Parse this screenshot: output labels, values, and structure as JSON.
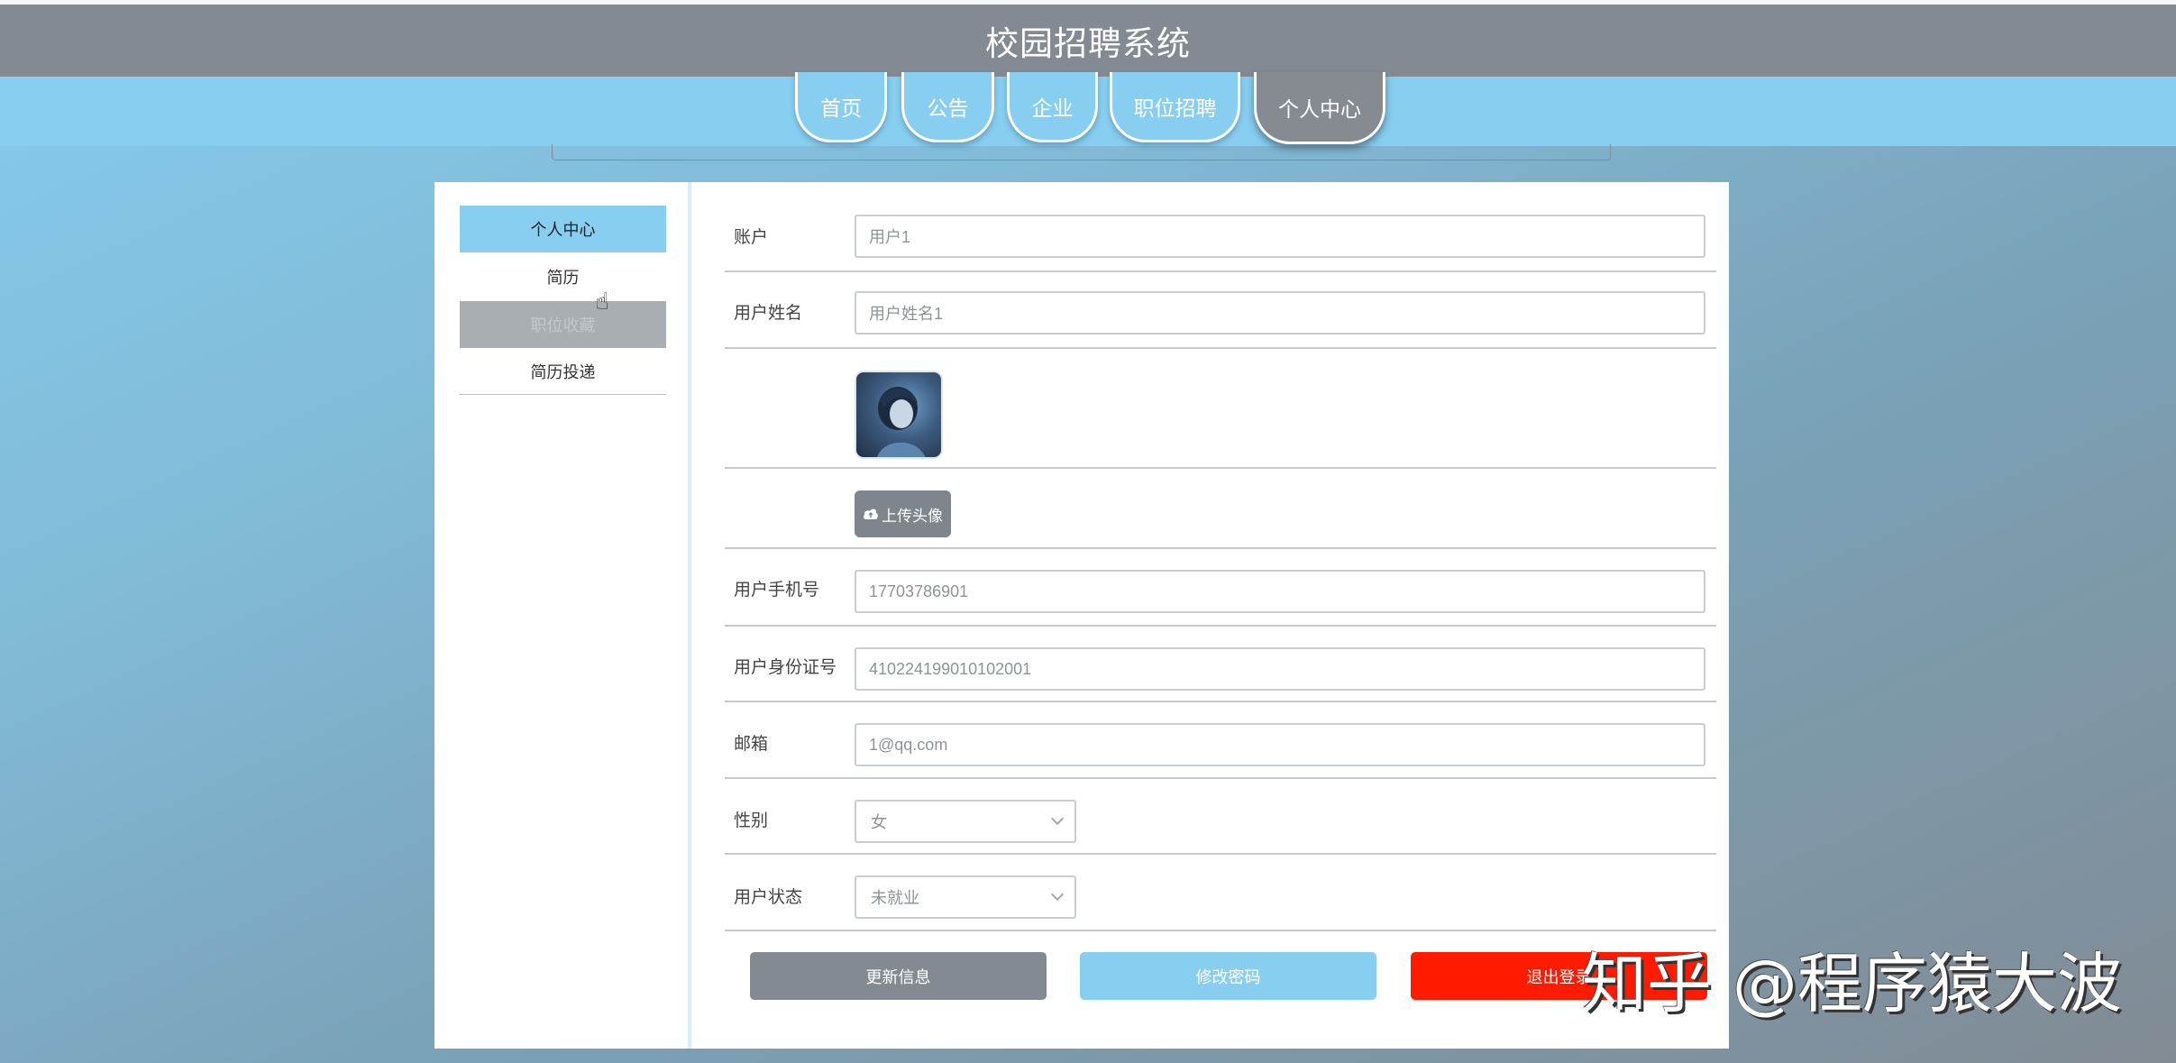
{
  "header": {
    "title": "校园招聘系统"
  },
  "nav": {
    "tabs": [
      {
        "label": "首页"
      },
      {
        "label": "公告"
      },
      {
        "label": "企业"
      },
      {
        "label": "职位招聘"
      },
      {
        "label": "个人中心",
        "active": true
      }
    ]
  },
  "sidebar": {
    "items": [
      {
        "label": "个人中心",
        "state": "active"
      },
      {
        "label": "简历",
        "state": "hover"
      },
      {
        "label": "职位收藏",
        "state": "muted"
      },
      {
        "label": "简历投递",
        "state": "normal"
      }
    ]
  },
  "form": {
    "account": {
      "label": "账户",
      "value": "用户1"
    },
    "username": {
      "label": "用户姓名",
      "value": "用户姓名1"
    },
    "upload_label": "上传头像",
    "phone": {
      "label": "用户手机号",
      "value": "17703786901"
    },
    "id_card": {
      "label": "用户身份证号",
      "value": "410224199010102001"
    },
    "email": {
      "label": "邮箱",
      "value": "1@qq.com"
    },
    "gender": {
      "label": "性别",
      "value": "女"
    },
    "status": {
      "label": "用户状态",
      "value": "未就业"
    }
  },
  "actions": {
    "update": "更新信息",
    "change_password": "修改密码",
    "logout": "退出登录"
  },
  "watermark": "知乎 @程序猿大波",
  "colors": {
    "accent_blue": "#87cef0",
    "header_gray": "#838a92",
    "logout_red": "#ff1a00"
  }
}
